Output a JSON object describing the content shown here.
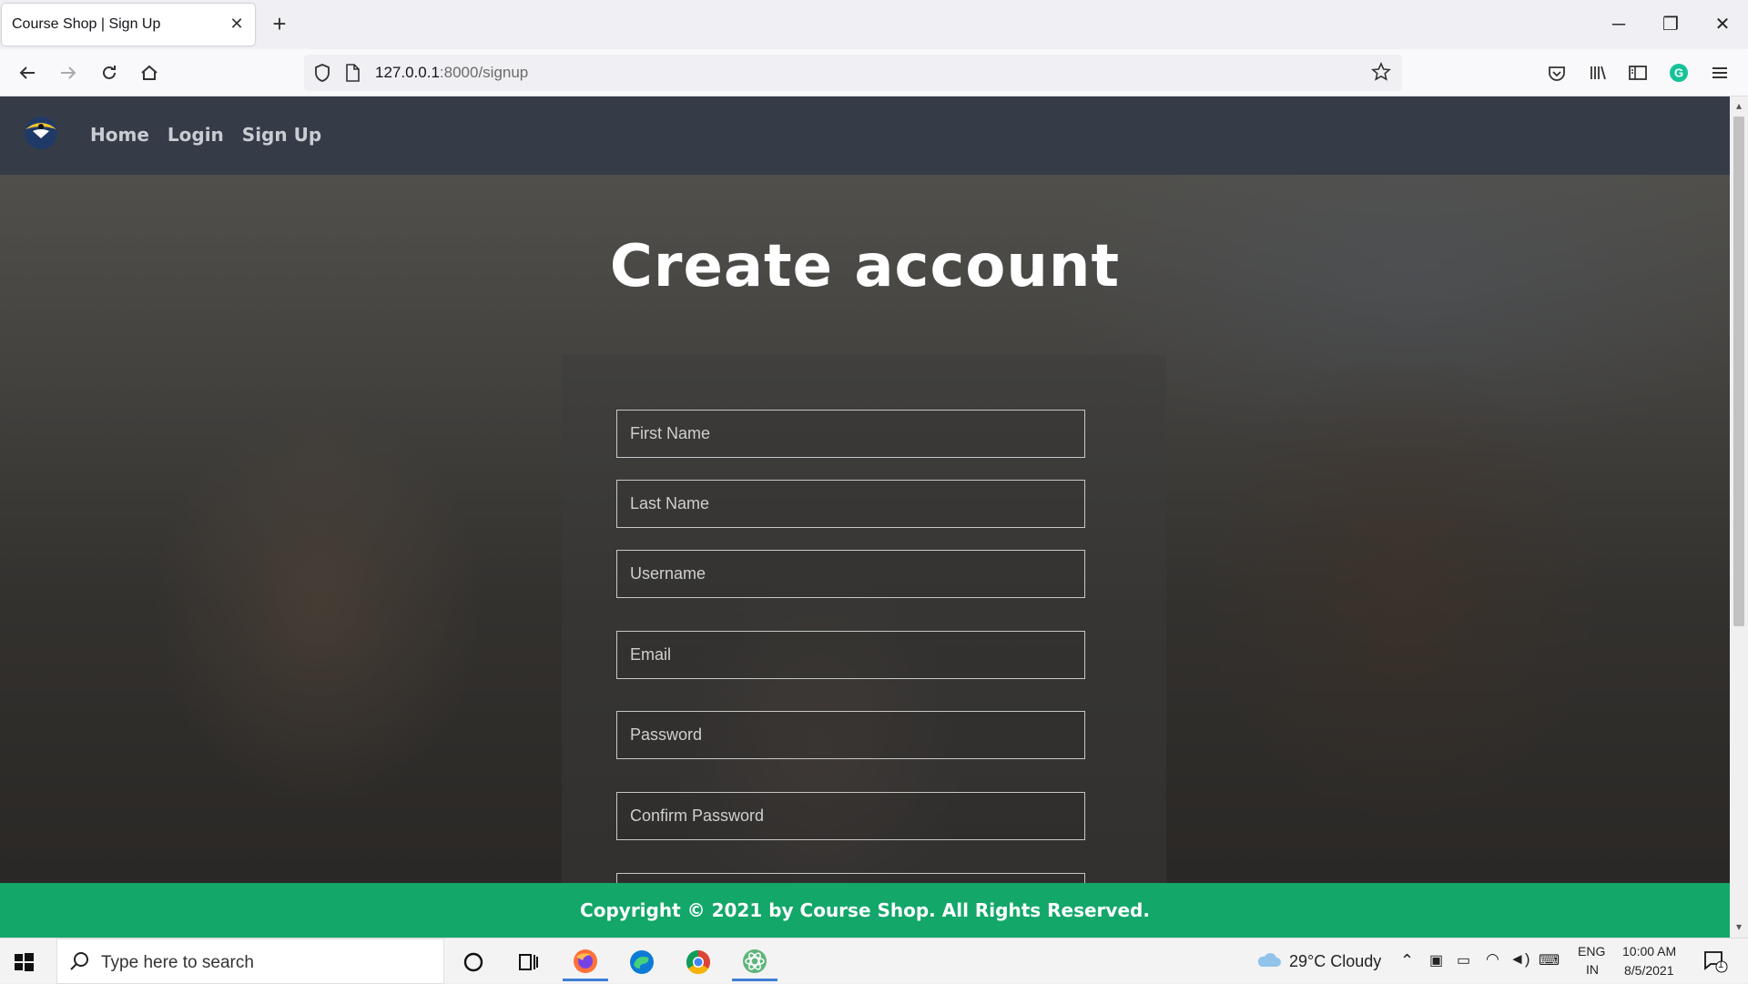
{
  "browser": {
    "tab_title": "Course Shop | Sign Up",
    "url_host": "127.0.0.1",
    "url_path": ":8000/signup"
  },
  "site": {
    "nav": [
      "Home",
      "Login",
      "Sign Up"
    ],
    "title": "Create account",
    "fields": {
      "first_name": "First Name",
      "last_name": "Last Name",
      "username": "Username",
      "email": "Email",
      "password": "Password",
      "confirm_password": "Confirm Password"
    },
    "footer": "Copyright © 2021 by Course Shop. All Rights Reserved."
  },
  "taskbar": {
    "search_placeholder": "Type here to search",
    "weather": "29°C  Cloudy",
    "lang_1": "ENG",
    "lang_2": "IN",
    "time": "10:00 AM",
    "date": "8/5/2021",
    "notifications": "1"
  },
  "colors": {
    "site_header": "#363c47",
    "footer": "#13a76a",
    "nav_link": "#c9cdd3"
  }
}
